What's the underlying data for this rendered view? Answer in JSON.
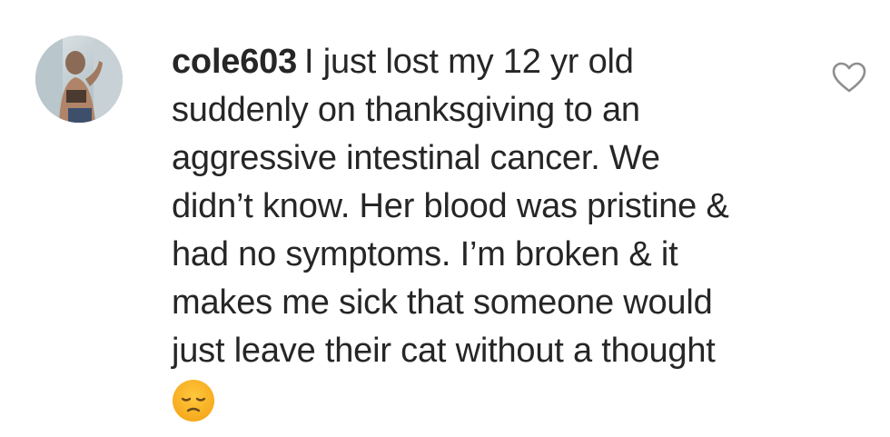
{
  "comment": {
    "username": "cole603",
    "text_lines": [
      "I just lost my 12 yr old",
      "suddenly on thanksgiving to an",
      "aggressive intestinal cancer. We",
      "didn’t know. Her blood was pristine &",
      "had no symptoms. I’m broken & it",
      "makes me sick that someone would",
      "just leave their cat without a thought"
    ],
    "emoji": "pensive-face-emoji",
    "like_icon": "heart-outline-icon"
  },
  "colors": {
    "text": "#262626",
    "icon_stroke": "#8e8e8e",
    "emoji_face": "#f6a81c"
  }
}
